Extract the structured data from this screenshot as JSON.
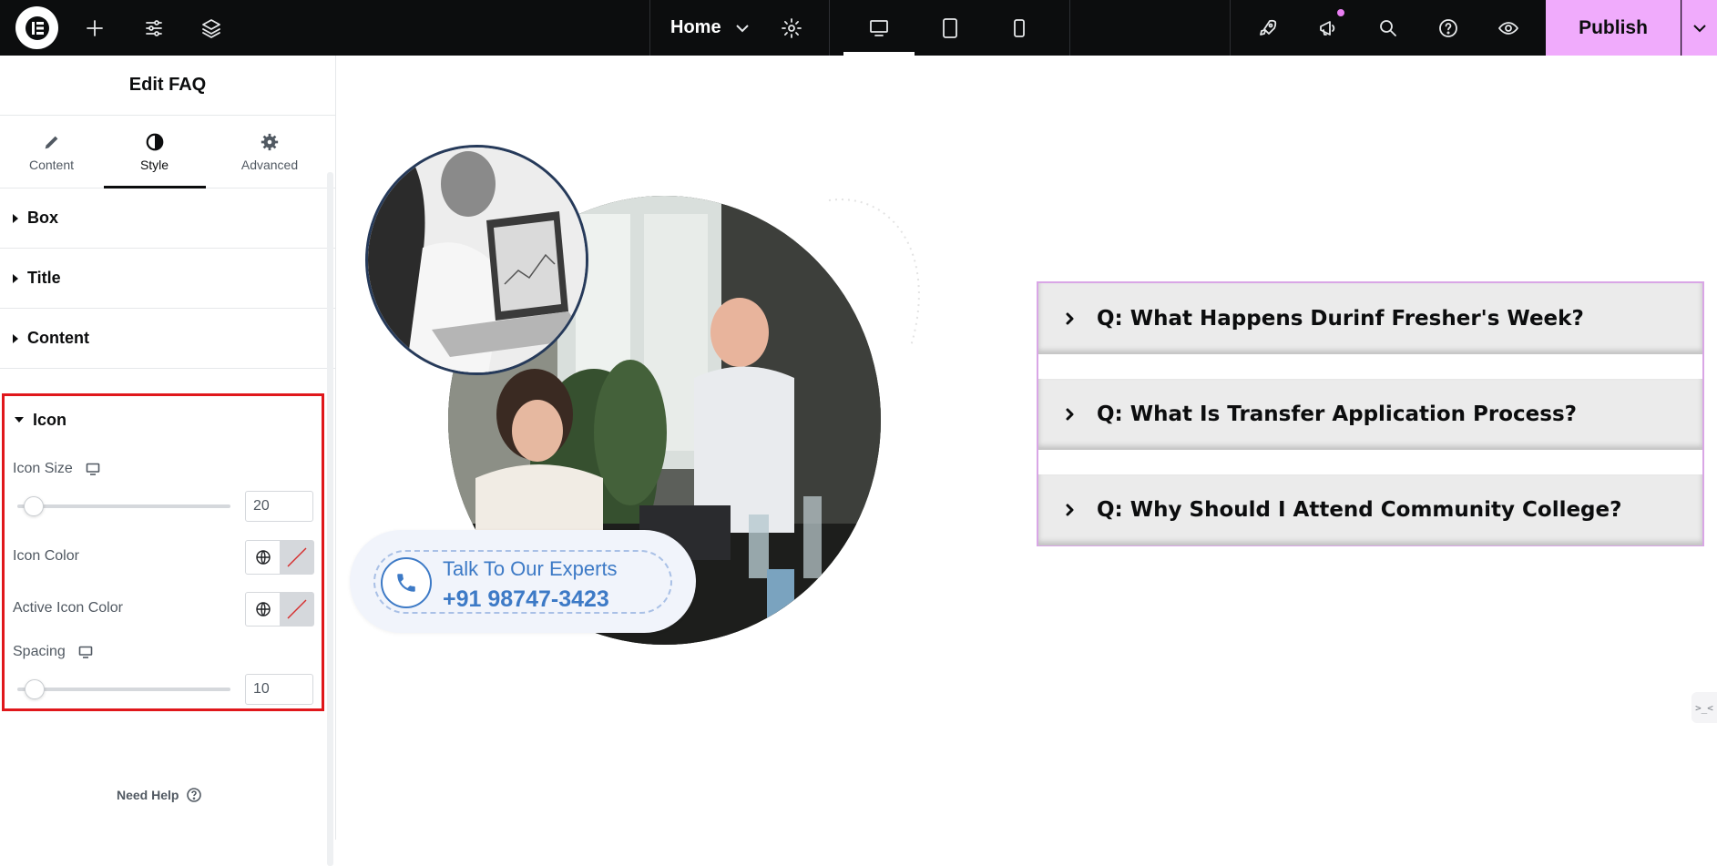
{
  "topbar": {
    "page_name": "Home",
    "publish_label": "Publish",
    "icons": [
      "elementor-logo-icon",
      "add-icon",
      "settings-sliders-icon",
      "layers-icon",
      "gear-icon",
      "desktop-icon",
      "tablet-icon",
      "mobile-icon",
      "rocket-icon",
      "megaphone-icon",
      "search-icon",
      "help-icon",
      "eye-icon",
      "chevron-down-icon"
    ]
  },
  "panel": {
    "title": "Edit FAQ",
    "tabs": [
      {
        "label": "Content",
        "icon": "pencil-icon"
      },
      {
        "label": "Style",
        "icon": "half-circle-icon"
      },
      {
        "label": "Advanced",
        "icon": "gear-icon"
      }
    ],
    "active_tab": "Style",
    "sections": [
      "Box",
      "Title",
      "Content"
    ],
    "icon_section": {
      "title": "Icon",
      "icon_size_label": "Icon Size",
      "icon_size_value": "20",
      "icon_color_label": "Icon Color",
      "active_icon_color_label": "Active Icon Color",
      "spacing_label": "Spacing",
      "spacing_value": "10"
    },
    "need_help": "Need Help"
  },
  "canvas": {
    "cta_title": "Talk To Our Experts",
    "cta_phone": "+91 98747-3423",
    "faq": [
      "Q: What Happens Durinf Fresher's Week?",
      "Q: What Is Transfer Application Process?",
      "Q: Why Should I Attend Community College?"
    ],
    "side_widget": ">_<"
  },
  "colors": {
    "topbar_bg": "#0c0d0e",
    "publish_bg": "#f0abfc",
    "highlight_border": "#e0171b",
    "faq_border": "#d9a6e6",
    "cta_blue": "#3d7ac6"
  }
}
